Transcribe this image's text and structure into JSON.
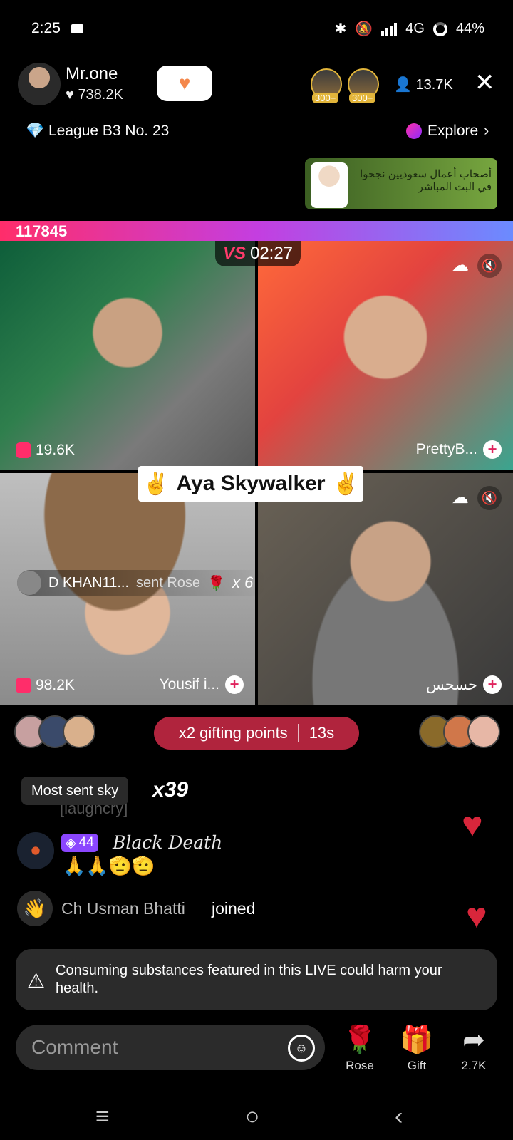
{
  "status_bar": {
    "time": "2:25",
    "network": "4G",
    "battery": "44%"
  },
  "host": {
    "name": "Mr.one",
    "likes": "738.2K",
    "follow_icon": "heart-plus-icon"
  },
  "top_gifters": [
    {
      "badge": "300+"
    },
    {
      "badge": "300+"
    }
  ],
  "viewers": "13.7K",
  "league": "League B3 No. 23",
  "explore_label": "Explore",
  "banner_text": "أصحاب أعمال سعوديين نجحوا في البث المباشر",
  "score": "117845",
  "battle_timer": "02:27",
  "tiles": [
    {
      "count": "19.6K"
    },
    {
      "name": "PrettyB..."
    },
    {
      "count": "98.2K",
      "name": "Yousif i..."
    },
    {
      "name": "حسحس"
    }
  ],
  "featured_name": "Aya Skywalker",
  "featured_emoji": "✌️",
  "gift_notice": {
    "sender": "D KHAN11...",
    "action": "sent Rose",
    "gift_icon": "🌹",
    "multiplier": "x 6"
  },
  "gifting_points": {
    "label": "x2 gifting points",
    "timer": "13s"
  },
  "chat": {
    "most_sent_label": "Most sent sky",
    "multiplier": "x39",
    "faded_line": "[laughcry]",
    "message": {
      "level": "44",
      "user": "Black Death",
      "text": "🙏🙏🫡🫡"
    },
    "join": {
      "user": "Ch Usman Bhatti",
      "action": "joined"
    }
  },
  "warning": "Consuming substances featured in this LIVE could harm your health.",
  "comment_placeholder": "Comment",
  "actions": [
    {
      "label": "Rose",
      "icon": "🌹"
    },
    {
      "label": "Gift",
      "icon": "🎁"
    },
    {
      "label": "2.7K",
      "icon": "➦"
    }
  ],
  "colors": {
    "accent": "#ff2d6a",
    "points_pill": "#b0243d",
    "level_badge": "#8b46ff",
    "heart": "#d8263b"
  }
}
